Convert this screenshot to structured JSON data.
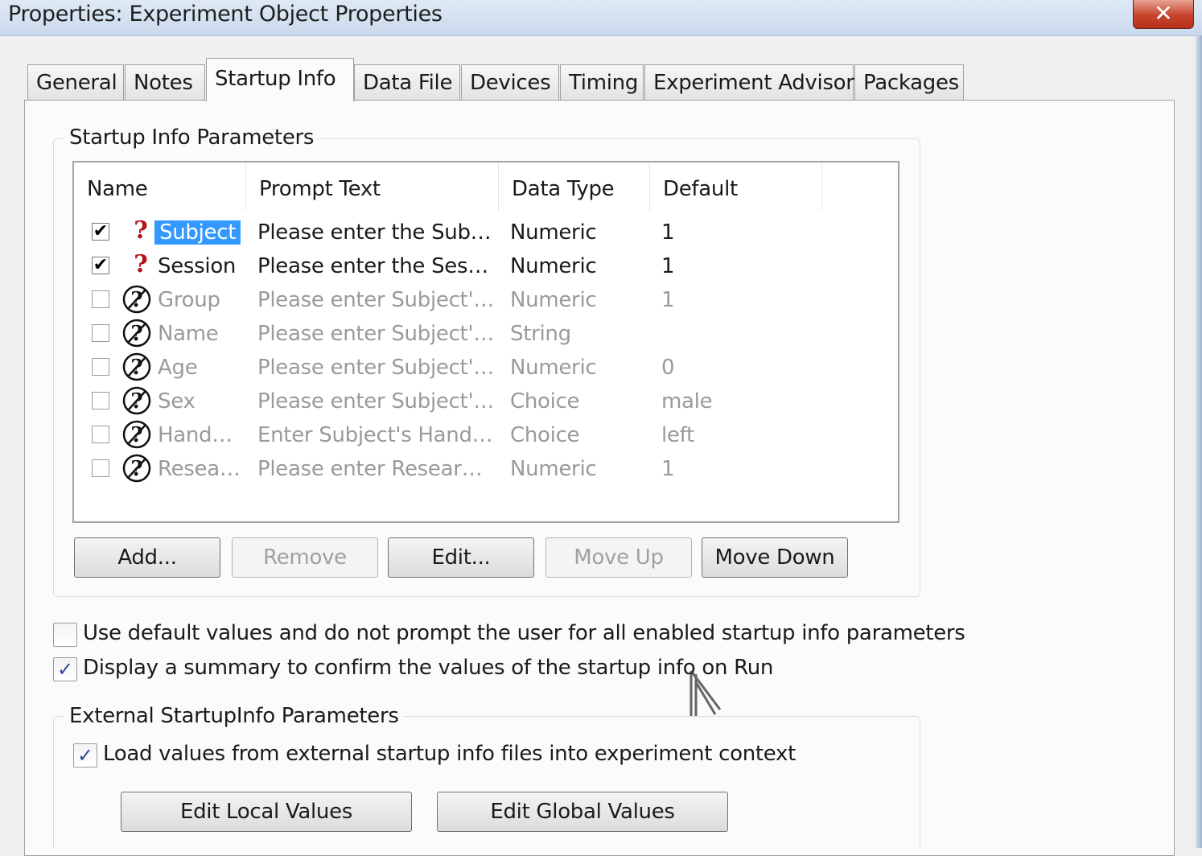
{
  "window": {
    "title": "Properties: Experiment Object Properties",
    "close_label": "✕"
  },
  "tabs": [
    {
      "label": "General",
      "active": false
    },
    {
      "label": "Notes",
      "active": false
    },
    {
      "label": "Startup Info",
      "active": true
    },
    {
      "label": "Data File",
      "active": false
    },
    {
      "label": "Devices",
      "active": false
    },
    {
      "label": "Timing",
      "active": false
    },
    {
      "label": "Experiment Advisor",
      "active": false
    },
    {
      "label": "Packages",
      "active": false
    }
  ],
  "startup_group": {
    "label": "Startup Info Parameters",
    "columns": [
      "Name",
      "Prompt Text",
      "Data Type",
      "Default"
    ],
    "rows": [
      {
        "checked": true,
        "name": "Subject",
        "prompt": "Please enter the Sub…",
        "type": "Numeric",
        "default": "1",
        "selected": true
      },
      {
        "checked": true,
        "name": "Session",
        "prompt": "Please enter the Ses…",
        "type": "Numeric",
        "default": "1"
      },
      {
        "checked": false,
        "name": "Group",
        "prompt": "Please enter Subject'…",
        "type": "Numeric",
        "default": "1"
      },
      {
        "checked": false,
        "name": "Name",
        "prompt": "Please enter Subject'…",
        "type": "String",
        "default": ""
      },
      {
        "checked": false,
        "name": "Age",
        "prompt": "Please enter Subject'…",
        "type": "Numeric",
        "default": "0"
      },
      {
        "checked": false,
        "name": "Sex",
        "prompt": "Please enter Subject'…",
        "type": "Choice",
        "default": "male"
      },
      {
        "checked": false,
        "name": "Hand…",
        "prompt": "Enter Subject's Hand…",
        "type": "Choice",
        "default": "left"
      },
      {
        "checked": false,
        "name": "Resea…",
        "prompt": "Please enter Resear…",
        "type": "Numeric",
        "default": "1"
      }
    ],
    "buttons": {
      "add": "Add...",
      "remove": "Remove",
      "edit": "Edit...",
      "move_up": "Move Up",
      "move_down": "Move Down"
    }
  },
  "options": {
    "use_default": {
      "label": "Use default values and do not prompt the user for all enabled startup info parameters",
      "checked": false
    },
    "display_summary": {
      "label": "Display a summary to confirm the values of the startup info on Run",
      "checked": true
    }
  },
  "external_group": {
    "label": "External StartupInfo Parameters",
    "load_values": {
      "label": "Load values from external startup info files into experiment context",
      "checked": true
    },
    "buttons": {
      "edit_local": "Edit Local Values",
      "edit_global": "Edit Global Values"
    }
  }
}
